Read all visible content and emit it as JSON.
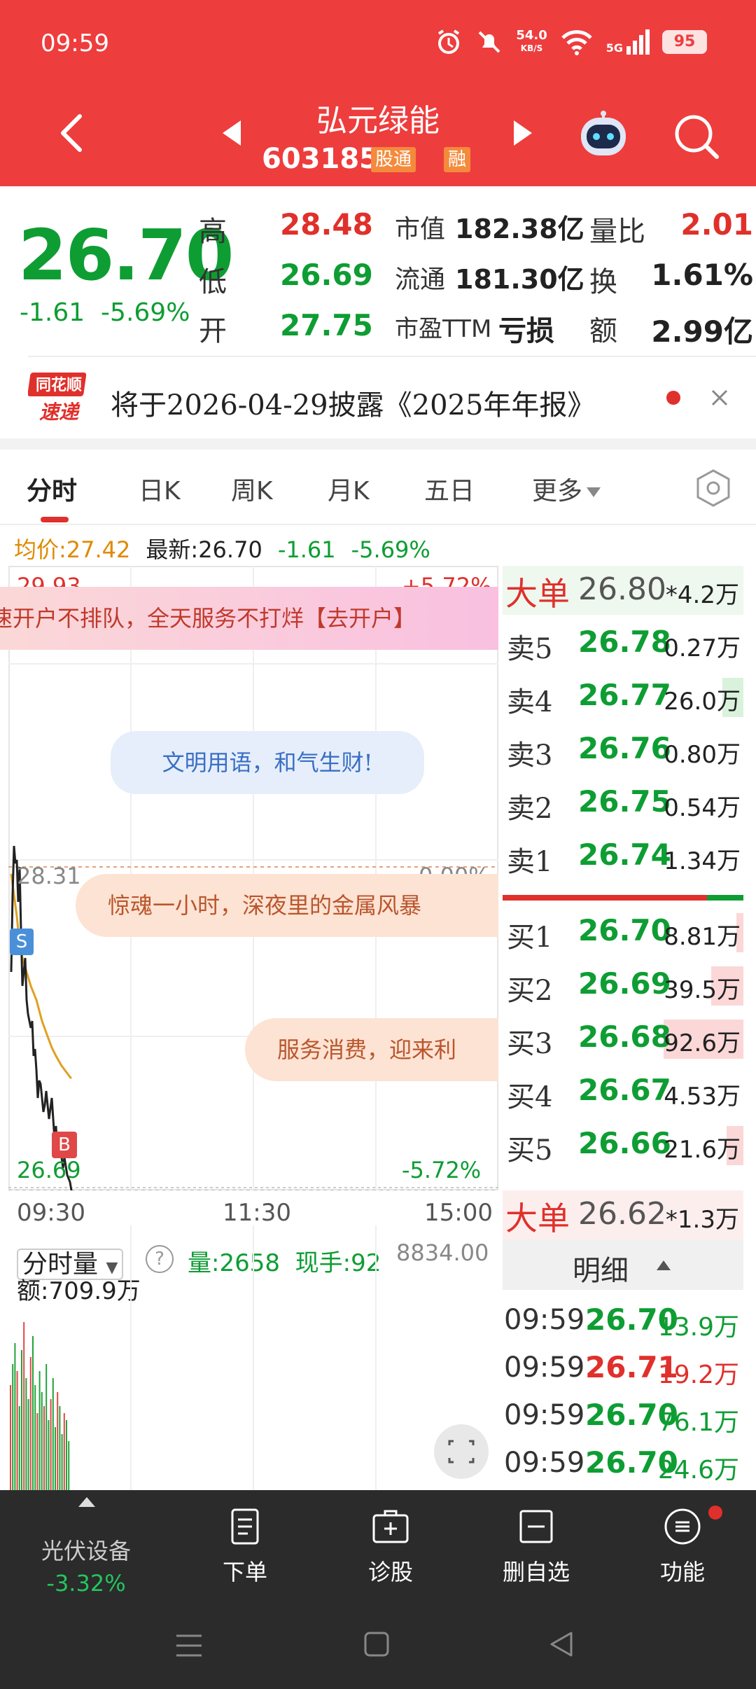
{
  "status_bar": {
    "time": "09:59",
    "net_speed": "54.0",
    "net_unit": "KB/S",
    "signal": "5G",
    "battery": "95"
  },
  "header": {
    "stock_name": "弘元绿能",
    "stock_code": "603185",
    "tag_1": "股通",
    "tag_2": "融"
  },
  "quote": {
    "price": "26.70",
    "change": "-1.61",
    "change_pct": "-5.69%",
    "high_label": "高",
    "high": "28.48",
    "low_label": "低",
    "low": "26.69",
    "open_label": "开",
    "open": "27.75",
    "mcap_label": "市值",
    "mcap": "182.38亿",
    "float_label": "流通",
    "float": "181.30亿",
    "pe_label": "市盈TTM",
    "pe": "亏损",
    "vol_ratio_label": "量比",
    "vol_ratio": "2.01",
    "turnover_label": "换",
    "turnover": "1.61%",
    "amount_label": "额",
    "amount": "2.99亿"
  },
  "notice": {
    "logo_top": "同花顺",
    "logo_bottom": "速递",
    "text": "将于2026-04-29披露《2025年年报》"
  },
  "tabs": {
    "t1": "分时",
    "t2": "日K",
    "t3": "周K",
    "t4": "月K",
    "t5": "五日",
    "t6": "更多"
  },
  "info_line": {
    "avg": "均价:27.42",
    "latest": "最新:26.70",
    "chg": "-1.61",
    "pct": "-5.69%"
  },
  "chart": {
    "high_price": "29.93",
    "high_pct": "+5.72%",
    "prev_close": "28.31",
    "prev_pct": "0.00%",
    "low_price": "26.69",
    "low_pct": "-5.72%",
    "marker_s": "S",
    "marker_b": "B",
    "time_start": "09:30",
    "time_mid": "11:30",
    "time_end": "15:00"
  },
  "banners": {
    "b1": "速开户不排队，全天服务不打烊【去开户】",
    "b2": "文明用语，和气生财!",
    "b3": "惊魂一小时，深夜里的金属风暴",
    "b4": "服务消费，迎来利"
  },
  "order_book": {
    "big_sell": {
      "label": "大单",
      "price": "26.80",
      "vol": "*4.2万"
    },
    "asks": [
      {
        "label": "卖5",
        "price": "26.78",
        "vol": "0.27万"
      },
      {
        "label": "卖4",
        "price": "26.77",
        "vol": "26.0万"
      },
      {
        "label": "卖3",
        "price": "26.76",
        "vol": "0.80万"
      },
      {
        "label": "卖2",
        "price": "26.75",
        "vol": "0.54万"
      },
      {
        "label": "卖1",
        "price": "26.74",
        "vol": "1.34万"
      }
    ],
    "bids": [
      {
        "label": "买1",
        "price": "26.70",
        "vol": "8.81万"
      },
      {
        "label": "买2",
        "price": "26.69",
        "vol": "39.5万"
      },
      {
        "label": "买3",
        "price": "26.68",
        "vol": "92.6万"
      },
      {
        "label": "买4",
        "price": "26.67",
        "vol": "4.53万"
      },
      {
        "label": "买5",
        "price": "26.66",
        "vol": "21.6万"
      }
    ],
    "big_buy": {
      "label": "大单",
      "price": "26.62",
      "vol": "*1.3万"
    }
  },
  "detail": {
    "title": "明细",
    "trades": [
      {
        "time": "09:59",
        "price": "26.70",
        "vol": "13.9万"
      },
      {
        "time": "09:59",
        "price": "26.71",
        "vol": "19.2万"
      },
      {
        "time": "09:59",
        "price": "26.70",
        "vol": "76.1万"
      },
      {
        "time": "09:59",
        "price": "26.70",
        "vol": "24.6万"
      }
    ]
  },
  "volume": {
    "selector": "分时量",
    "vol": "量:2658",
    "cur": "现手:92",
    "max": "8834.00",
    "amount": "额:709.9万"
  },
  "bottom_bar": {
    "sector_name": "光伏设备",
    "sector_chg": "-3.32%",
    "b1": "下单",
    "b2": "诊股",
    "b3": "删自选",
    "b4": "功能"
  },
  "colors": {
    "header_red": "#ee3d3d",
    "down_green": "#0e9d33",
    "up_red": "#e0302b",
    "avg_orange": "#e08a00"
  }
}
